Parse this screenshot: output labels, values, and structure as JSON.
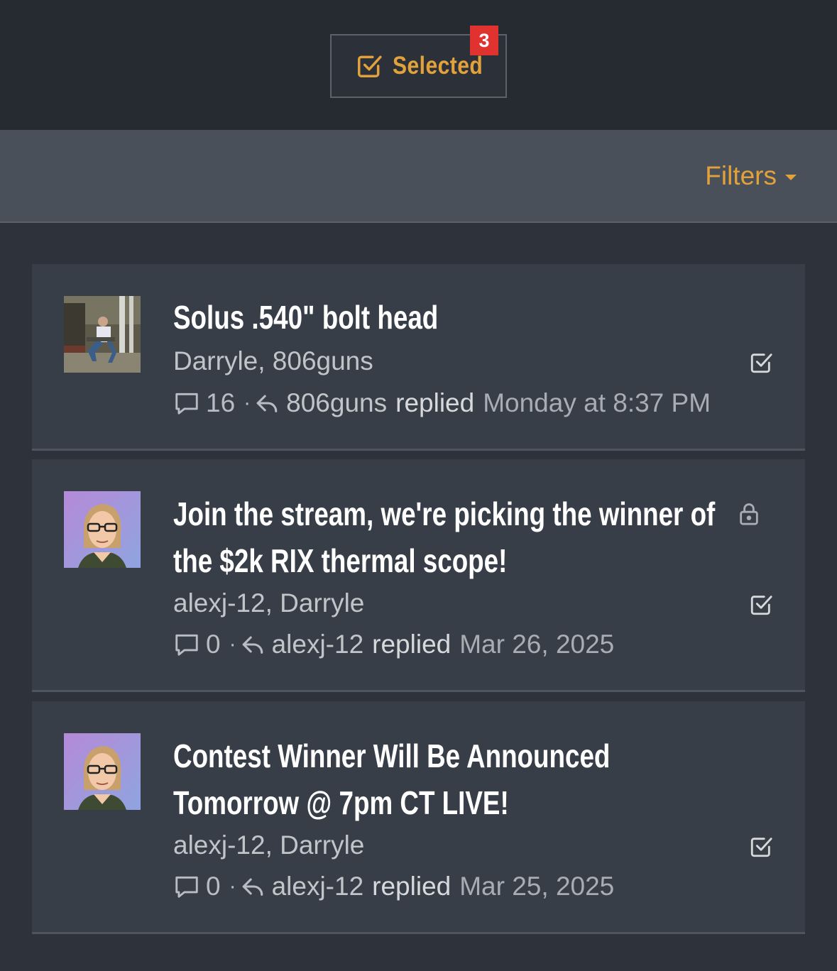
{
  "header": {
    "selected_label": "Selected",
    "selected_count": "3",
    "accent_color": "#e2a23b",
    "badge_color": "#e0322f"
  },
  "filters": {
    "label": "Filters"
  },
  "threads": [
    {
      "title": "Solus .540\" bolt head",
      "starters": "Darryle, 806guns",
      "reply_count": "16",
      "last_replier": "806guns",
      "replied_verb": "replied",
      "last_date": "Monday at 8:37 PM",
      "locked": false,
      "avatar": "photo-avatar"
    },
    {
      "title": "Join the stream, we're picking the winner of the $2k RIX thermal scope!",
      "starters": "alexj-12, Darryle",
      "reply_count": "0",
      "last_replier": "alexj-12",
      "replied_verb": "replied",
      "last_date": "Mar 26, 2025",
      "locked": true,
      "avatar": "illustrated-avatar"
    },
    {
      "title": "Contest Winner Will Be Announced Tomorrow @ 7pm CT LIVE!",
      "starters": "alexj-12, Darryle",
      "reply_count": "0",
      "last_replier": "alexj-12",
      "replied_verb": "replied",
      "last_date": "Mar 25, 2025",
      "locked": false,
      "avatar": "illustrated-avatar"
    }
  ]
}
